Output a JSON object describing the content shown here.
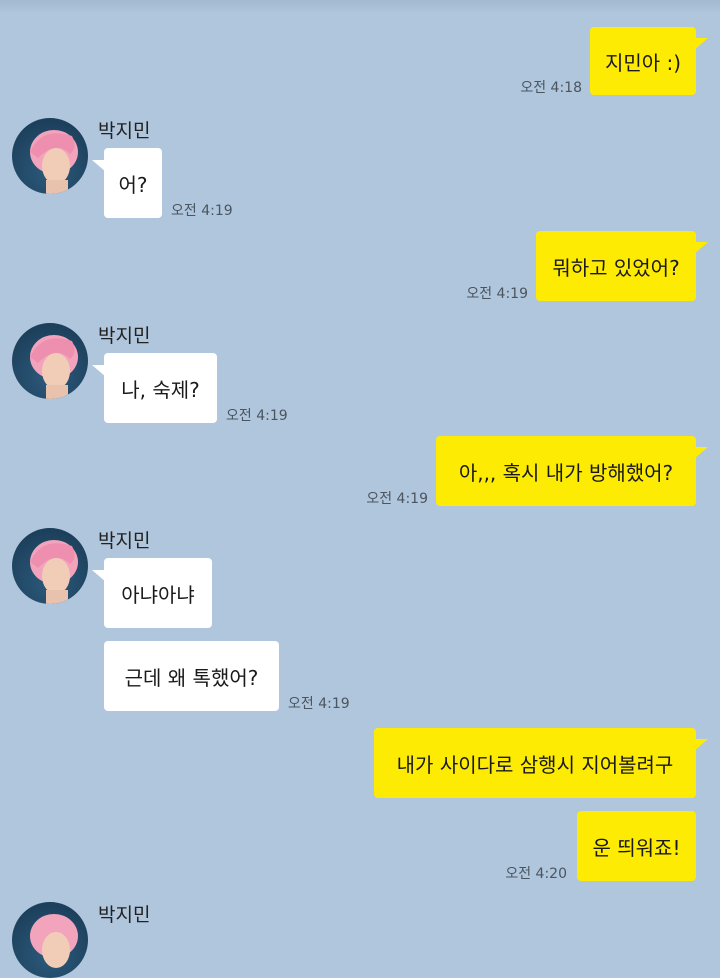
{
  "chat": {
    "sender_name": "박지민",
    "messages": [
      {
        "text": "지민아 :)",
        "time": "오전 4:18"
      },
      {
        "text": "어?",
        "time": "오전 4:19"
      },
      {
        "text": "뭐하고 있었어?",
        "time": "오전 4:19"
      },
      {
        "text": "나, 숙제?",
        "time": "오전 4:19"
      },
      {
        "text": "아,,, 혹시 내가 방해했어?",
        "time": "오전 4:19"
      },
      {
        "text": "아냐아냐"
      },
      {
        "text": "근데 왜 톡했어?",
        "time": "오전 4:19"
      },
      {
        "text": "내가 사이다로 삼행시 지어볼려구"
      },
      {
        "text": "운 띄워죠!",
        "time": "오전 4:20"
      }
    ]
  },
  "colors": {
    "background": "#b0c6dc",
    "my_bubble": "#fdeb04",
    "their_bubble": "#ffffff"
  }
}
